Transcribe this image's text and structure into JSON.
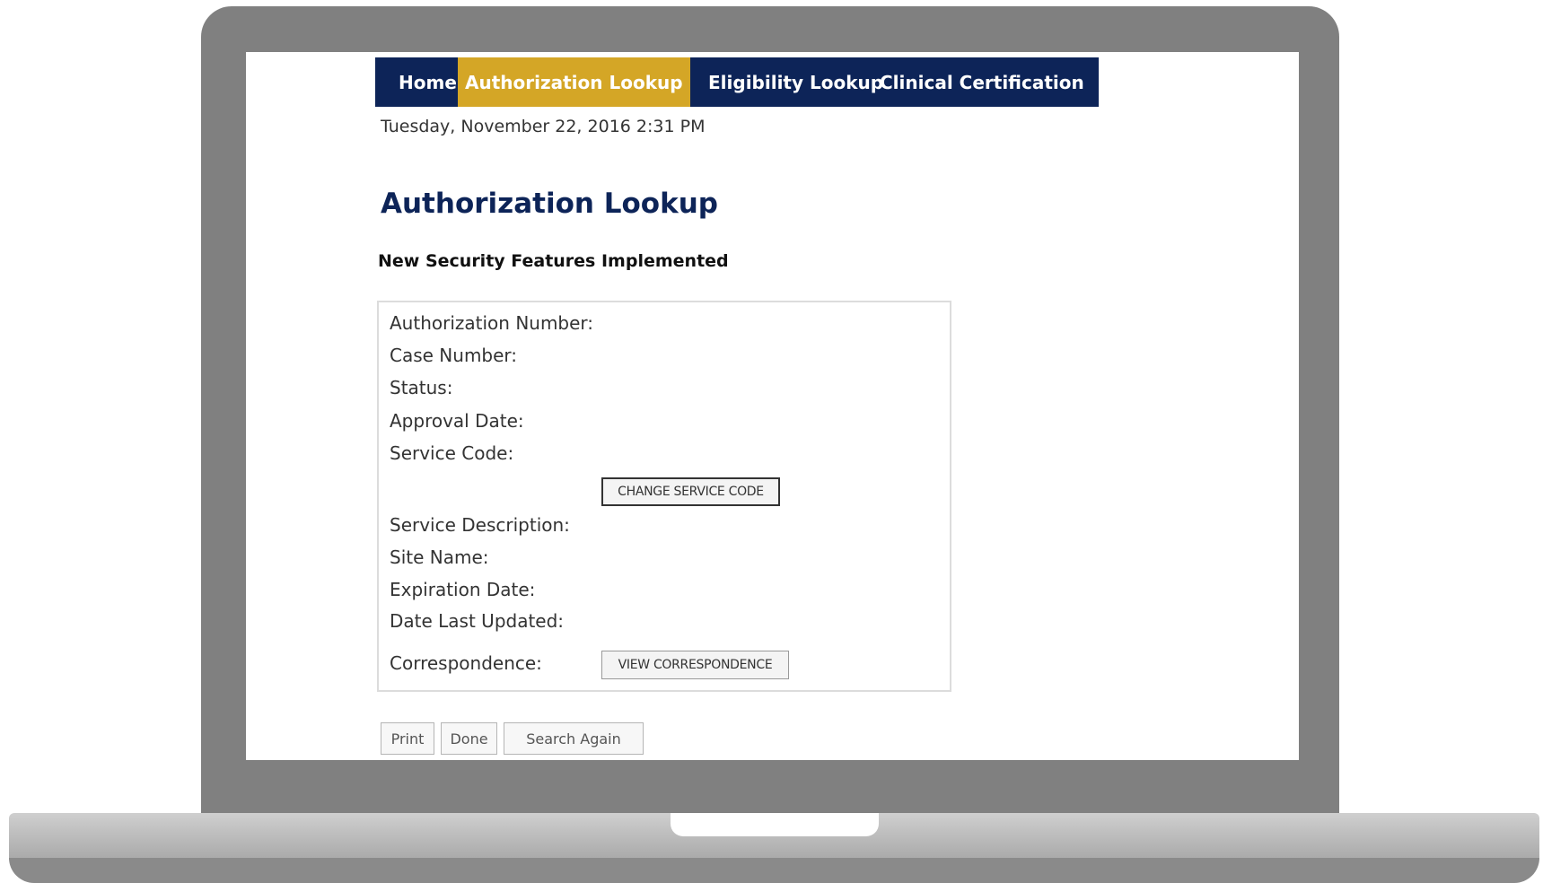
{
  "nav": {
    "home": "Home",
    "authorization_lookup": "Authorization Lookup",
    "eligibility_lookup": "Eligibility Lookup",
    "clinical_certification": "Clinical Certification"
  },
  "datetime": "Tuesday, November 22, 2016 2:31 PM",
  "page_title": "Authorization Lookup",
  "security_note": "New Security Features Implemented",
  "details": {
    "authorization_number_label": "Authorization Number:",
    "case_number_label": "Case Number:",
    "status_label": "Status:",
    "approval_date_label": "Approval Date:",
    "service_code_label": "Service Code:",
    "change_service_code_button": "CHANGE SERVICE CODE",
    "service_description_label": "Service Description:",
    "site_name_label": "Site Name:",
    "expiration_date_label": "Expiration Date:",
    "date_last_updated_label": "Date Last Updated:",
    "correspondence_label": "Correspondence:",
    "view_correspondence_button": "VIEW CORRESPONDENCE"
  },
  "actions": {
    "print": "Print",
    "done": "Done",
    "search_again": "Search Again"
  },
  "colors": {
    "nav_background": "#0d2458",
    "nav_active": "#d4a626",
    "title": "#0d2458",
    "laptop_frame": "#808080"
  }
}
